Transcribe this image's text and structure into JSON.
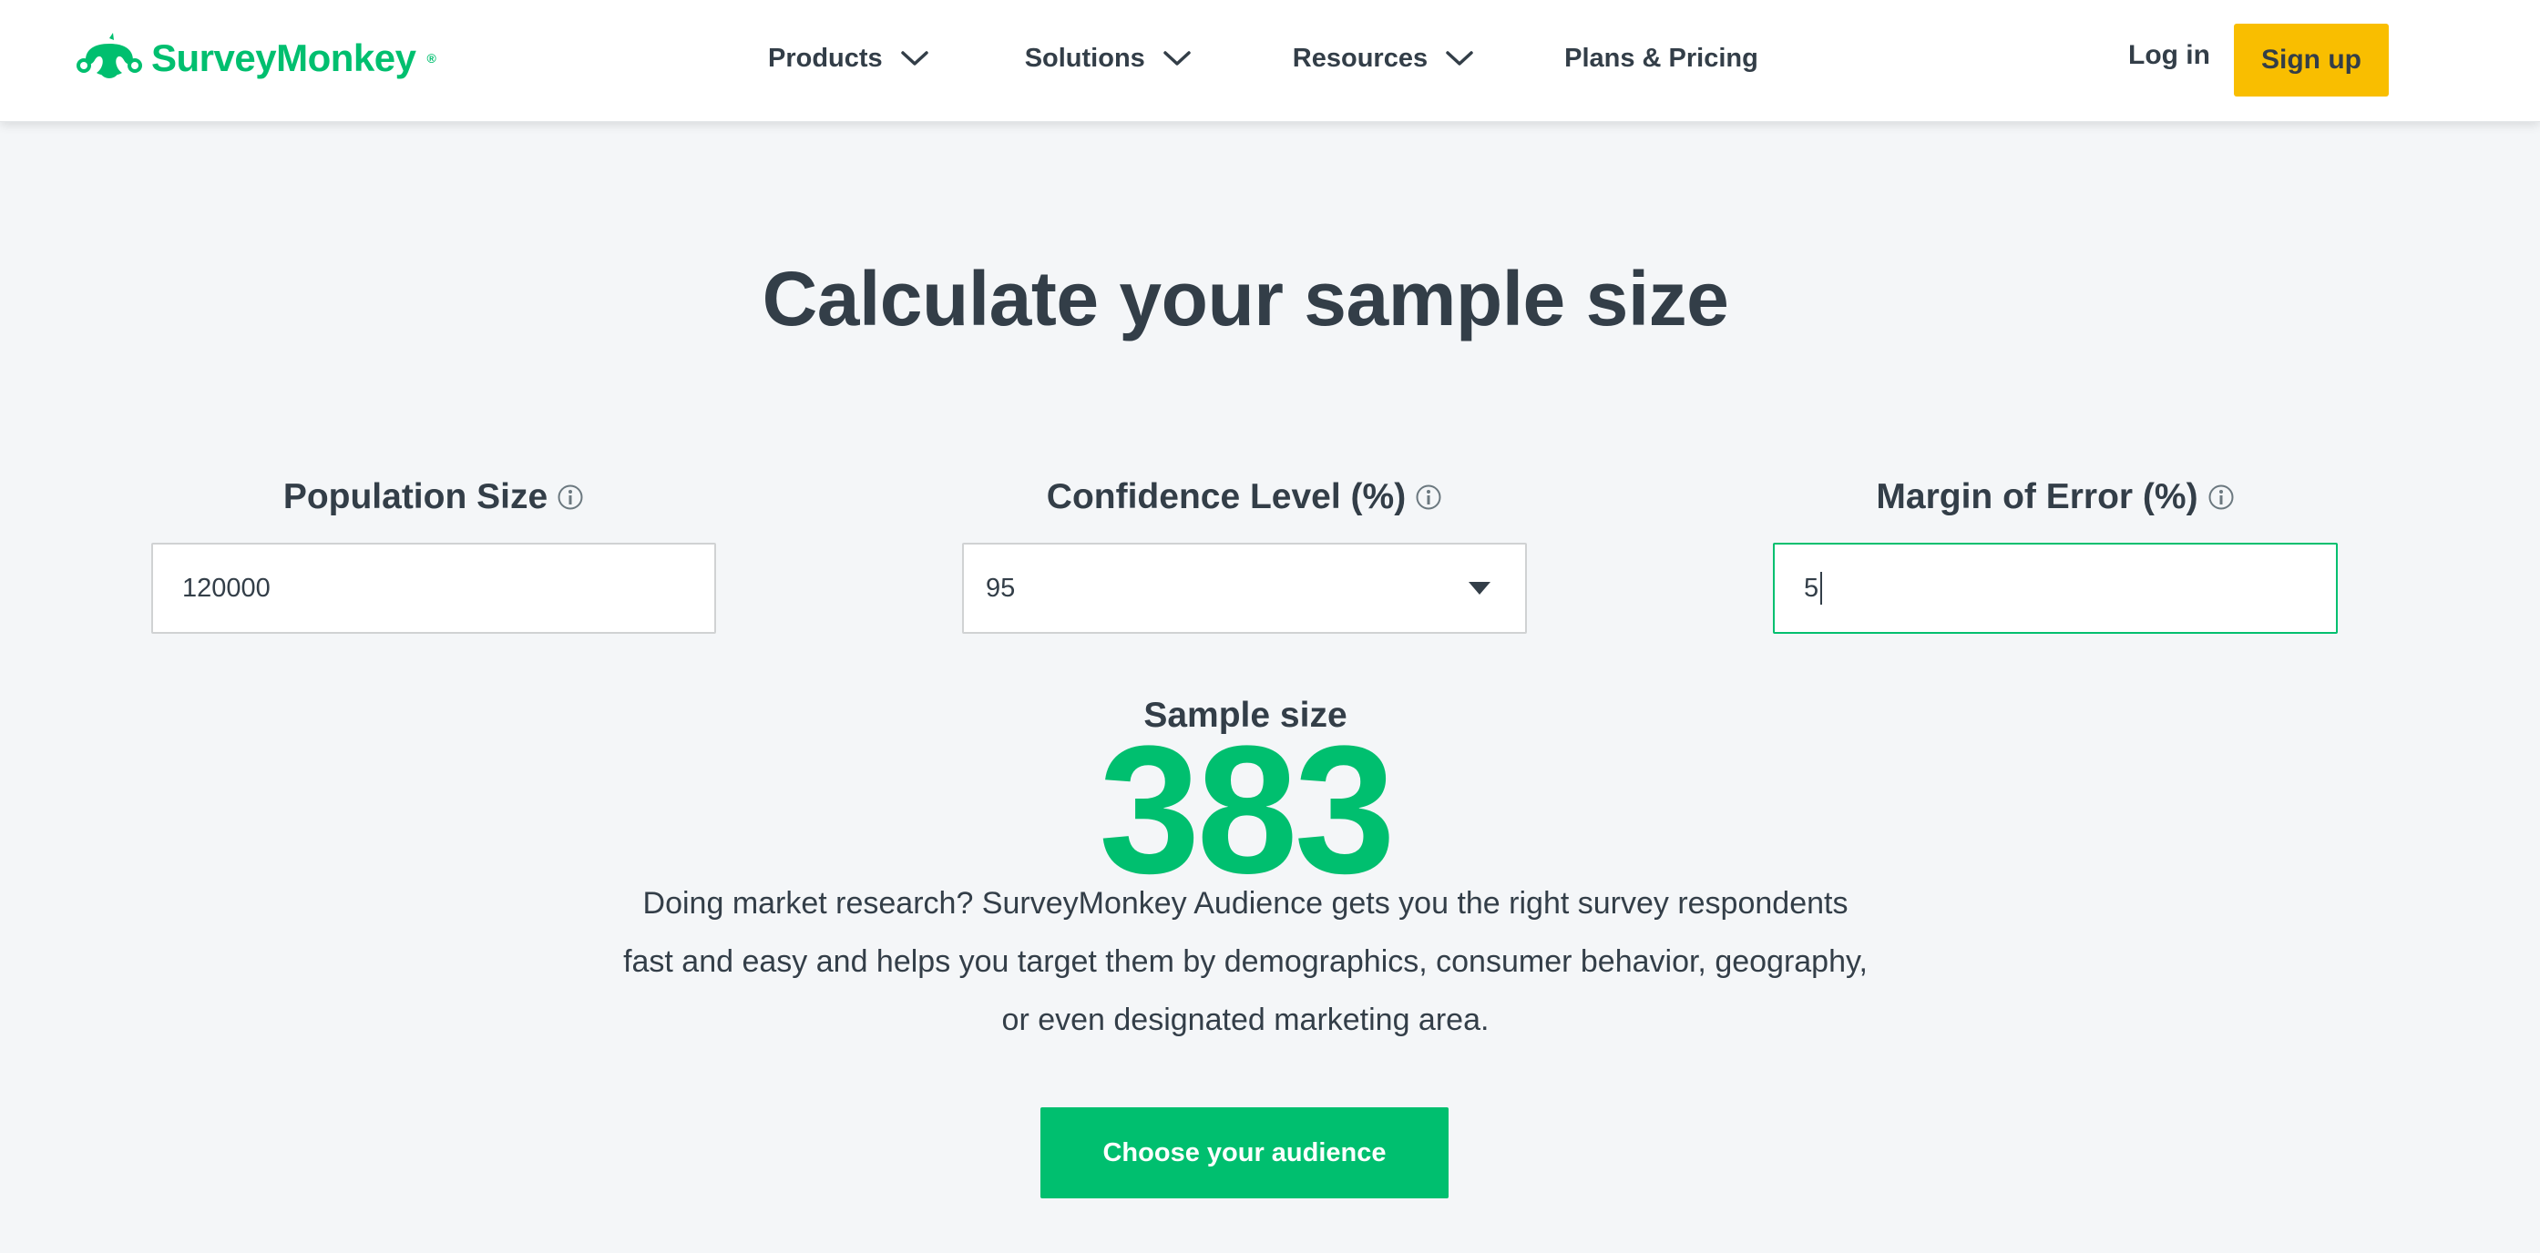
{
  "header": {
    "brand": "SurveyMonkey",
    "brand_mark": "®",
    "nav": [
      {
        "label": "Products",
        "icon": "chevron-down-icon"
      },
      {
        "label": "Solutions",
        "icon": "chevron-down-icon"
      },
      {
        "label": "Resources",
        "icon": "chevron-down-icon"
      },
      {
        "label": "Plans & Pricing"
      }
    ],
    "login_label": "Log in",
    "signup_label": "Sign up"
  },
  "calculator": {
    "title": "Calculate your sample size",
    "population": {
      "label": "Population Size",
      "value": "120000",
      "icon": "info-icon"
    },
    "confidence": {
      "label": "Confidence Level (%)",
      "value": "95",
      "icon": "info-icon"
    },
    "margin": {
      "label": "Margin of Error (%)",
      "value": "5",
      "icon": "info-icon"
    },
    "result_label": "Sample size",
    "result_value": "383"
  },
  "promo": {
    "text": "Doing market research? SurveyMonkey Audience gets you the right survey respondents fast and easy and helps you target them by demographics, consumer behavior, geography, or even designated marketing area.",
    "cta_label": "Choose your audience"
  },
  "colors": {
    "brand_green": "#00bf6f",
    "signup_yellow": "#f9be00",
    "text_dark": "#333e48",
    "background": "#f4f6f8"
  }
}
